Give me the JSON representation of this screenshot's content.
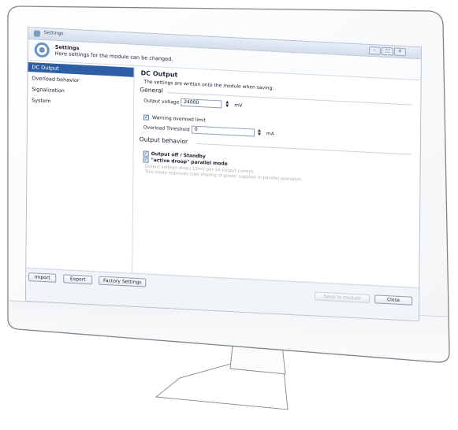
{
  "window": {
    "title": "Settings",
    "controls": [
      "–",
      "□",
      "✕"
    ]
  },
  "header": {
    "title": "Settings",
    "subtitle": "Here settings for the module can be changed."
  },
  "sidebar": {
    "items": [
      {
        "label": "DC Output",
        "active": true
      },
      {
        "label": "Overload behavior",
        "active": false
      },
      {
        "label": "Signalization",
        "active": false
      },
      {
        "label": "System",
        "active": false
      }
    ]
  },
  "content": {
    "title": "DC Output",
    "description": "The settings are written onto the module when saving.",
    "general": {
      "title": "General",
      "output_voltage_label": "Output voltage",
      "output_voltage_value": "24000",
      "output_voltage_unit": "mV",
      "warning_overload_label": "Warning overload limit",
      "warning_overload_checked": true,
      "overload_threshold_label": "Overload Threshold",
      "overload_threshold_value": "0",
      "overload_threshold_unit": "mA"
    },
    "output_behavior": {
      "title": "Output behavior",
      "standby_label": "Output off / Standby",
      "standby_checked": true,
      "droop_label": "\"active droop\" parallel mode",
      "droop_checked": true,
      "droop_note_line1": "Output voltage drops 10mV per 1A output current.",
      "droop_note_line2": "This mode improves load sharing of power supplies in parallel operation."
    }
  },
  "footer": {
    "import_label": "Import",
    "export_label": "Export",
    "factory_label": "Factory Settings",
    "save_label": "Save to module",
    "close_label": "Close"
  },
  "colors": {
    "accent": "#2e5fa6",
    "screen_bg": "#f4f6f9",
    "monitor_frame": "#ffffff"
  },
  "icons": {
    "window": "settings-window-icon",
    "header": "gear-icon",
    "spinner": "spinner-arrows-icon",
    "checkbox": "checkmark-icon"
  }
}
